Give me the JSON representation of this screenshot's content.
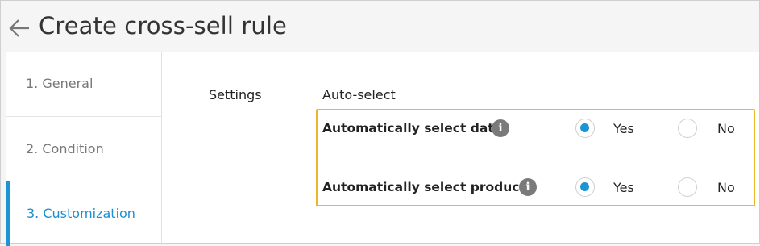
{
  "header": {
    "title": "Create cross-sell rule",
    "back_icon": "arrow-left-icon"
  },
  "sidebar": {
    "steps": [
      {
        "label": "1. General",
        "active": false
      },
      {
        "label": "2. Condition",
        "active": false
      },
      {
        "label": "3. Customization",
        "active": true
      }
    ]
  },
  "main": {
    "settings_label": "Settings",
    "section_heading": "Auto-select",
    "rows": [
      {
        "label": "Automatically select date",
        "info_icon": "info-icon",
        "selected": "Yes",
        "yes": "Yes",
        "no": "No"
      },
      {
        "label": "Automatically select products",
        "info_icon": "info-icon",
        "selected": "Yes",
        "yes": "Yes",
        "no": "No"
      }
    ]
  },
  "colors": {
    "accent": "#1b95d4",
    "highlight_border": "#f0b429",
    "info_icon_bg": "#7a7a7a"
  }
}
